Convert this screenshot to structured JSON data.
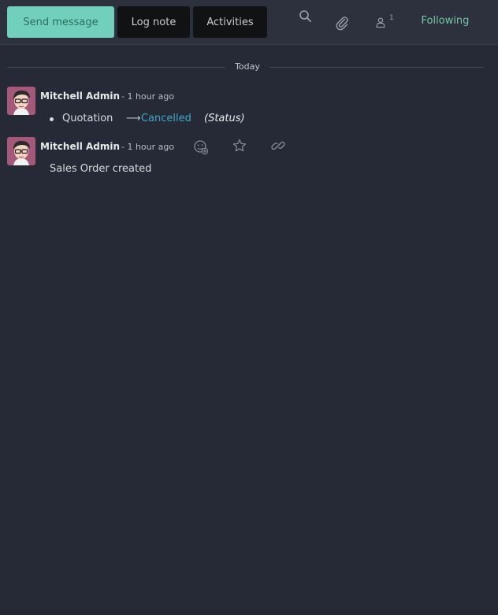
{
  "toolbar": {
    "send_message_label": "Send message",
    "log_note_label": "Log note",
    "activities_label": "Activities",
    "search_icon": "search-icon",
    "attachment_icon": "paperclip-icon",
    "followers_icon": "user-icon",
    "followers_count": "1",
    "following_label": "Following"
  },
  "separator": {
    "label": "Today"
  },
  "messages": [
    {
      "author": "Mitchell Admin",
      "date": "- 1 hour ago",
      "tracking": {
        "old_value": "Quotation",
        "arrow": "⟶",
        "new_value": "Cancelled",
        "field": "(Status)"
      }
    },
    {
      "author": "Mitchell Admin",
      "date": "- 1 hour ago",
      "body": "Sales Order created",
      "actions": [
        "add-reaction-icon",
        "star-icon",
        "link-icon"
      ]
    }
  ],
  "colors": {
    "background": "#262a36",
    "topbar": "#2d313d",
    "primary_button": "#71d0bb",
    "following": "#6fc7a8",
    "tracking_new_value": "#3ea8c9"
  }
}
